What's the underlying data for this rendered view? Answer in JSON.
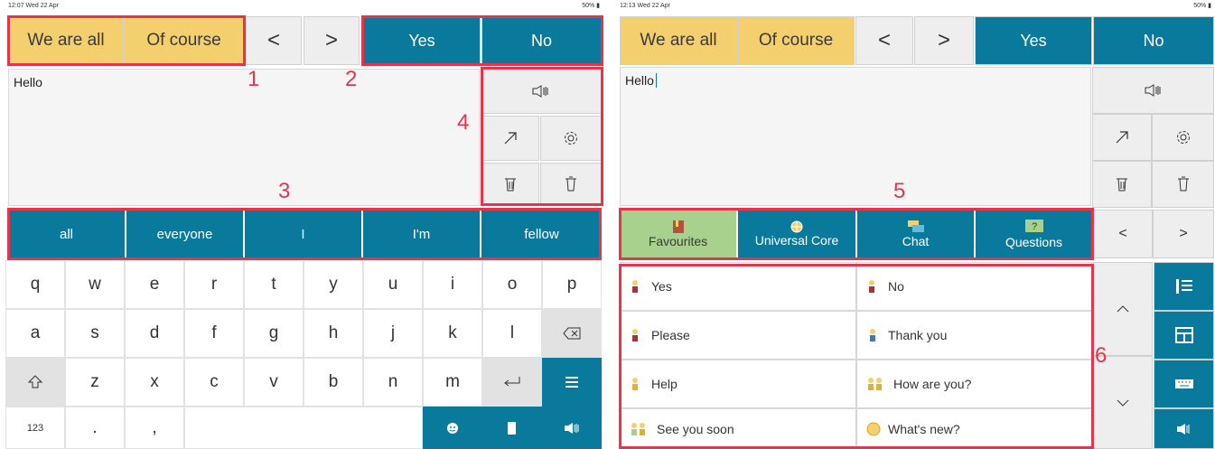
{
  "left": {
    "status": {
      "time": "12:07",
      "date": "Wed 22 Apr",
      "battery": "50%"
    },
    "top_buttons": {
      "quick1": "We are all",
      "quick2": "Of course",
      "prev": "<",
      "next": ">",
      "yes": "Yes",
      "no": "No"
    },
    "text_value": "Hello",
    "predictions": [
      "all",
      "everyone",
      "I",
      "I'm",
      "fellow"
    ],
    "keyboard": {
      "row1": [
        "q",
        "w",
        "e",
        "r",
        "t",
        "y",
        "u",
        "i",
        "o",
        "p"
      ],
      "row2": [
        "a",
        "s",
        "d",
        "f",
        "g",
        "h",
        "j",
        "k",
        "l"
      ],
      "row3": [
        "z",
        "x",
        "c",
        "v",
        "b",
        "n",
        "m"
      ],
      "numbers_key": "123",
      "period_key": ".",
      "comma_key": ","
    },
    "callouts": [
      "1",
      "2",
      "3",
      "4"
    ]
  },
  "right": {
    "status": {
      "time": "12:13",
      "date": "Wed 22 Apr",
      "battery": "50%"
    },
    "top_buttons": {
      "quick1": "We are all",
      "quick2": "Of course",
      "prev": "<",
      "next": ">",
      "yes": "Yes",
      "no": "No"
    },
    "text_value": "Hello",
    "tabs": [
      "Favourites",
      "Universal Core",
      "Chat",
      "Questions"
    ],
    "tab_nav": {
      "prev": "<",
      "next": ">"
    },
    "phrases": [
      {
        "label": "Yes"
      },
      {
        "label": "No"
      },
      {
        "label": "Please"
      },
      {
        "label": "Thank you"
      },
      {
        "label": "Help"
      },
      {
        "label": "How are you?"
      },
      {
        "label": "See you soon"
      },
      {
        "label": "What's new?"
      }
    ],
    "callouts": [
      "5",
      "6"
    ]
  },
  "colors": {
    "accent_blue": "#0a7a9c",
    "quick_yellow": "#f4cf6e",
    "favourites_green": "#a9d18e",
    "callout_red": "#e8334a"
  }
}
